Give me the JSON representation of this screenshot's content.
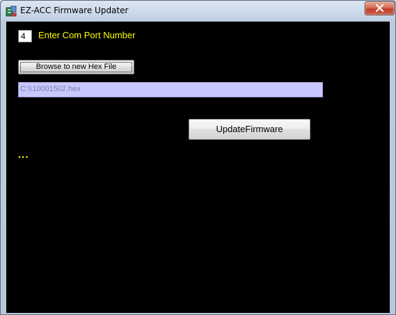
{
  "window": {
    "title": "EZ-ACC Firmware Updater",
    "app_icon": "app-icon",
    "close_icon": "close-icon"
  },
  "com_port": {
    "value": "4",
    "label": "Enter Com Port Number"
  },
  "browse": {
    "label": "Browse to new Hex File"
  },
  "hex_file": {
    "path": "C:\\\\10001502.hex"
  },
  "update": {
    "label": "UpdateFirmware"
  },
  "status": {
    "text": "..."
  },
  "colors": {
    "background": "#000000",
    "label_text": "#ffff00",
    "path_field": "#c8c8ff",
    "close_button": "#c4402a"
  }
}
